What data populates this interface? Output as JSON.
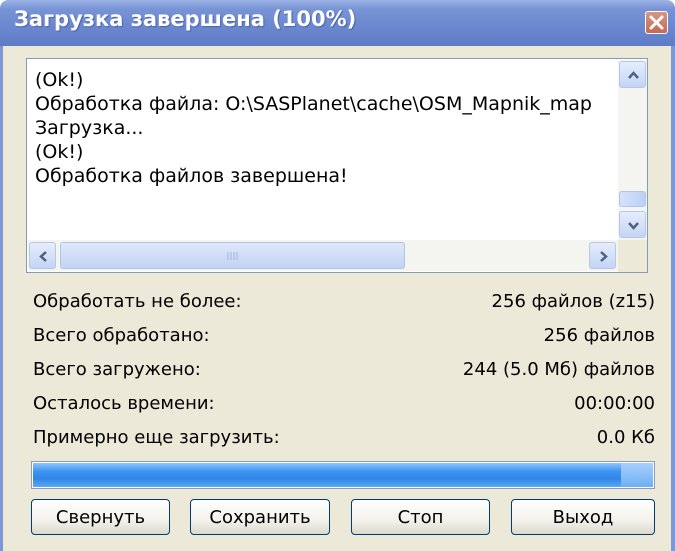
{
  "window": {
    "title": "Загрузка завершена (100%)",
    "close_icon": "close-icon"
  },
  "log": {
    "lines": [
      "(Ok!)",
      "Обработка файла: O:\\SASPlanet\\cache\\OSM_Mapnik_map",
      "Загрузка...",
      "(Ok!)",
      "Обработка файлов завершена!"
    ]
  },
  "stats": [
    {
      "label": "Обработать не более:",
      "value": "256 файлов (z15)"
    },
    {
      "label": "Всего обработано:",
      "value": "256 файлов"
    },
    {
      "label": "Всего загружено:",
      "value": "244 (5.0 Мб) файлов"
    },
    {
      "label": "Осталось времени:",
      "value": "00:00:00"
    },
    {
      "label": "Примерно еще загрузить:",
      "value": "0.0 Кб"
    }
  ],
  "progress": {
    "percent": 100,
    "color": "#2f86e8"
  },
  "buttons": {
    "collapse": "Свернуть",
    "save": "Сохранить",
    "stop": "Стоп",
    "exit": "Выход"
  },
  "colors": {
    "titlebar": "#6a87cf",
    "window_bg": "#ece9d8",
    "button_border": "#003c74"
  }
}
